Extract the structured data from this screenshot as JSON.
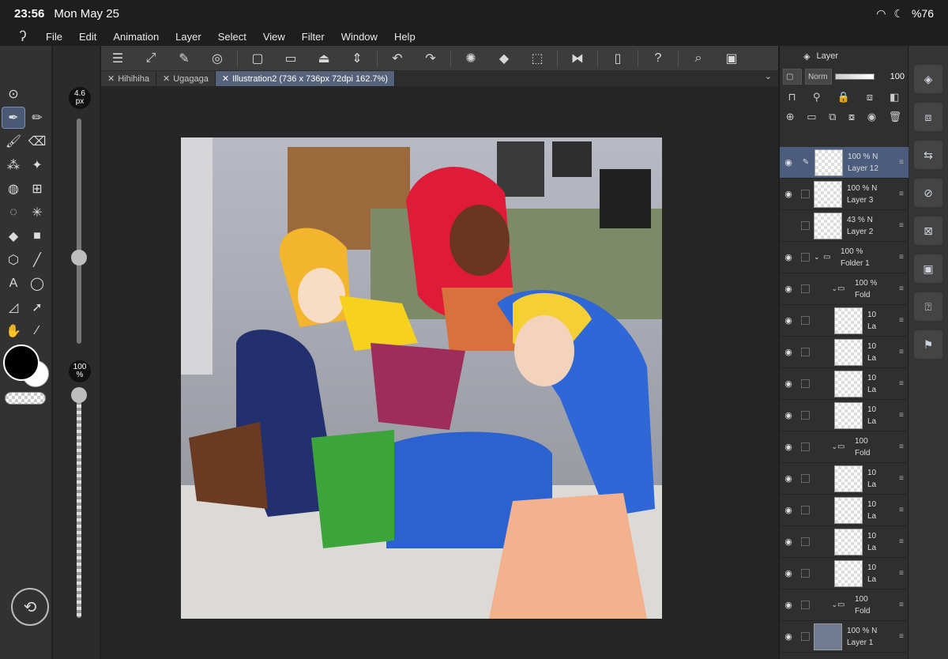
{
  "status": {
    "time": "23:56",
    "date": "Mon May 25",
    "battery": "%76"
  },
  "menu": [
    "File",
    "Edit",
    "Animation",
    "Layer",
    "Select",
    "View",
    "Filter",
    "Window",
    "Help"
  ],
  "brush": {
    "size_value": "4.6",
    "size_unit": "px",
    "opacity_value": "100",
    "opacity_unit": "%"
  },
  "tabs": [
    {
      "label": "Hihihiha"
    },
    {
      "label": "Ugagaga"
    },
    {
      "label": "Illustration2 (736 x 736px 72dpi 162.7%)"
    }
  ],
  "layers_panel": {
    "title": "Layer",
    "blend_mode": "Norm",
    "opacity": "100",
    "layers": [
      {
        "opacity": "100 %",
        "mode": "N",
        "name": "Layer 12"
      },
      {
        "opacity": "100 %",
        "mode": "N",
        "name": "Layer 3"
      },
      {
        "opacity": "43 %",
        "mode": "N",
        "name": "Layer 2"
      },
      {
        "opacity": "100 %",
        "mode": "",
        "name": "Folder 1"
      },
      {
        "opacity": "100 %",
        "mode": "",
        "name": "Fold"
      },
      {
        "opacity": "10",
        "mode": "",
        "name": "La"
      },
      {
        "opacity": "10",
        "mode": "",
        "name": "La"
      },
      {
        "opacity": "10",
        "mode": "",
        "name": "La"
      },
      {
        "opacity": "10",
        "mode": "",
        "name": "La"
      },
      {
        "opacity": "100",
        "mode": "",
        "name": "Fold"
      },
      {
        "opacity": "10",
        "mode": "",
        "name": "La"
      },
      {
        "opacity": "10",
        "mode": "",
        "name": "La"
      },
      {
        "opacity": "10",
        "mode": "",
        "name": "La"
      },
      {
        "opacity": "10",
        "mode": "",
        "name": "La"
      },
      {
        "opacity": "100",
        "mode": "",
        "name": "Fold"
      },
      {
        "opacity": "100 %",
        "mode": "N",
        "name": "Layer 1"
      }
    ]
  },
  "colors": {
    "panel": "#323232",
    "accent": "#4c5c7c",
    "tab_active": "#56627a"
  },
  "icons": {
    "toolbar": [
      "menu-icon",
      "fit-icon",
      "edit-icon",
      "target-icon",
      "new-canvas-icon",
      "open-icon",
      "save-icon",
      "arrows-icon",
      "undo-icon",
      "redo-icon",
      "loading-icon",
      "fill-icon",
      "crop-icon",
      "flip-icon",
      "phone-icon",
      "help-icon",
      "search-icon",
      "window-icon"
    ]
  }
}
